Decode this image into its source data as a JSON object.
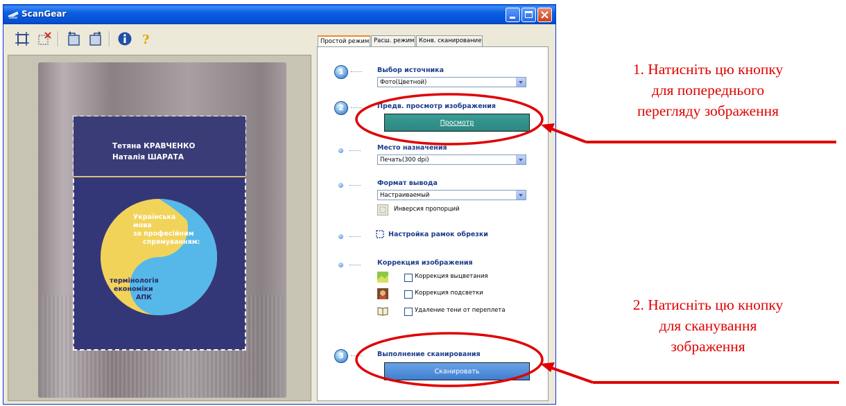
{
  "window": {
    "title": "ScanGear"
  },
  "tabs": [
    "Простой режим",
    "Расш. режим",
    "Конв. сканирование"
  ],
  "book": {
    "authors": [
      "Тетяна КРАВЧЕНКО",
      "Наталія ШАРАТА"
    ],
    "title_lines": [
      "Українська",
      "мова",
      "за професійним",
      "спрямуванням:",
      "термінологія",
      "економіки",
      "АПК"
    ]
  },
  "steps": {
    "source": {
      "number": "1",
      "title": "Выбор источника",
      "value": "Фото(Цветной)"
    },
    "preview": {
      "number": "2",
      "title": "Предв. просмотр изображения",
      "button": "Просмотр"
    },
    "destination": {
      "title": "Место назначения",
      "value": "Печать(300 dpi)"
    },
    "output": {
      "title": "Формат вывода",
      "value": "Настраиваемый",
      "invert": "Инверсия пропорций"
    },
    "crop": {
      "title": "Настройка рамок обрезки"
    },
    "correction": {
      "title": "Коррекция изображения",
      "items": [
        "Коррекция выцветания",
        "Коррекция подсветки",
        "Удаление тени от переплета"
      ]
    },
    "scan": {
      "number": "3",
      "title": "Выполнение сканирования",
      "button": "Сканировать"
    }
  },
  "annotations": {
    "note1": [
      "1. Натисніть цю кнопку",
      "для попереднього",
      "перегляду зображення"
    ],
    "note2": [
      "2. Натисніть цю кнопку",
      "для сканування",
      "зображення"
    ],
    "color": "#e00000"
  }
}
